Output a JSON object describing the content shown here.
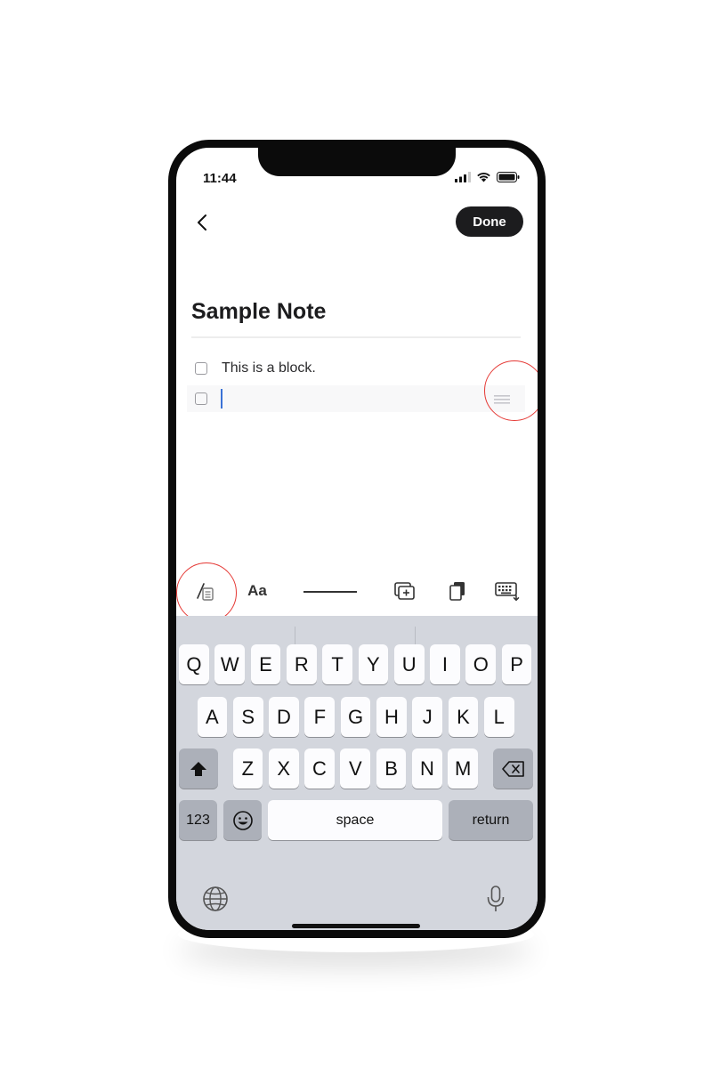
{
  "status": {
    "time": "11:44"
  },
  "header": {
    "done_label": "Done"
  },
  "note": {
    "title": "Sample Note",
    "blocks": [
      {
        "text": "This is a block.",
        "checked": false
      },
      {
        "text": "",
        "checked": false,
        "focused": true
      }
    ]
  },
  "toolbar": {
    "text_style_label": "Aa",
    "icons": [
      "slash-command-icon",
      "text-style-icon",
      "divider-icon",
      "add-block-icon",
      "copy-icon",
      "dismiss-keyboard-icon"
    ]
  },
  "keyboard": {
    "row1": [
      "Q",
      "W",
      "E",
      "R",
      "T",
      "Y",
      "U",
      "I",
      "O",
      "P"
    ],
    "row2": [
      "A",
      "S",
      "D",
      "F",
      "G",
      "H",
      "J",
      "K",
      "L"
    ],
    "row3": [
      "Z",
      "X",
      "C",
      "V",
      "B",
      "N",
      "M"
    ],
    "numbers_label": "123",
    "space_label": "space",
    "return_label": "return"
  },
  "colors": {
    "accent_caret": "#3a72d6",
    "done_bg": "#1c1c1e",
    "highlight": "#e53935"
  }
}
